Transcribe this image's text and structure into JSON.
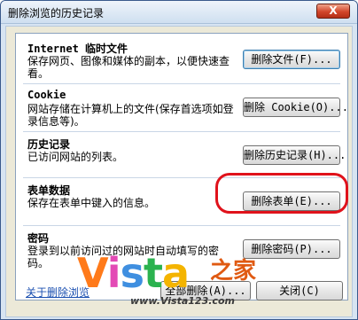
{
  "window": {
    "title": "删除浏览的历史记录",
    "close_glyph": "X"
  },
  "sections": {
    "internet": {
      "title": "Internet 临时文件",
      "desc": "保存网页、图像和媒体的副本，以便快速查看。",
      "button": "删除文件(F)..."
    },
    "cookie": {
      "title": "Cookie",
      "desc": "网站存储在计算机上的文件(保存首选项如登录信息等)。",
      "button": "删除 Cookie(O)..."
    },
    "history": {
      "title": "历史记录",
      "desc": "已访问网站的列表。",
      "button": "删除历史记录(H)..."
    },
    "form": {
      "title": "表单数据",
      "desc": "保存在表单中键入的信息。",
      "button": "删除表单(E)..."
    },
    "password": {
      "title": "密码",
      "desc": "登录到以前访问过的网站时自动填写的密码。",
      "button": "删除密码(P)..."
    }
  },
  "footer": {
    "link": "关于删除浏览",
    "delete_all": "全部删除(A)...",
    "close": "关闭(C)"
  },
  "watermark": {
    "big": [
      "V",
      "i",
      "s",
      "t",
      "a"
    ],
    "cn": "之家",
    "url": "www.Vista123.com"
  },
  "colors": {
    "highlight": "#e0121b",
    "link": "#1a4fb0"
  }
}
